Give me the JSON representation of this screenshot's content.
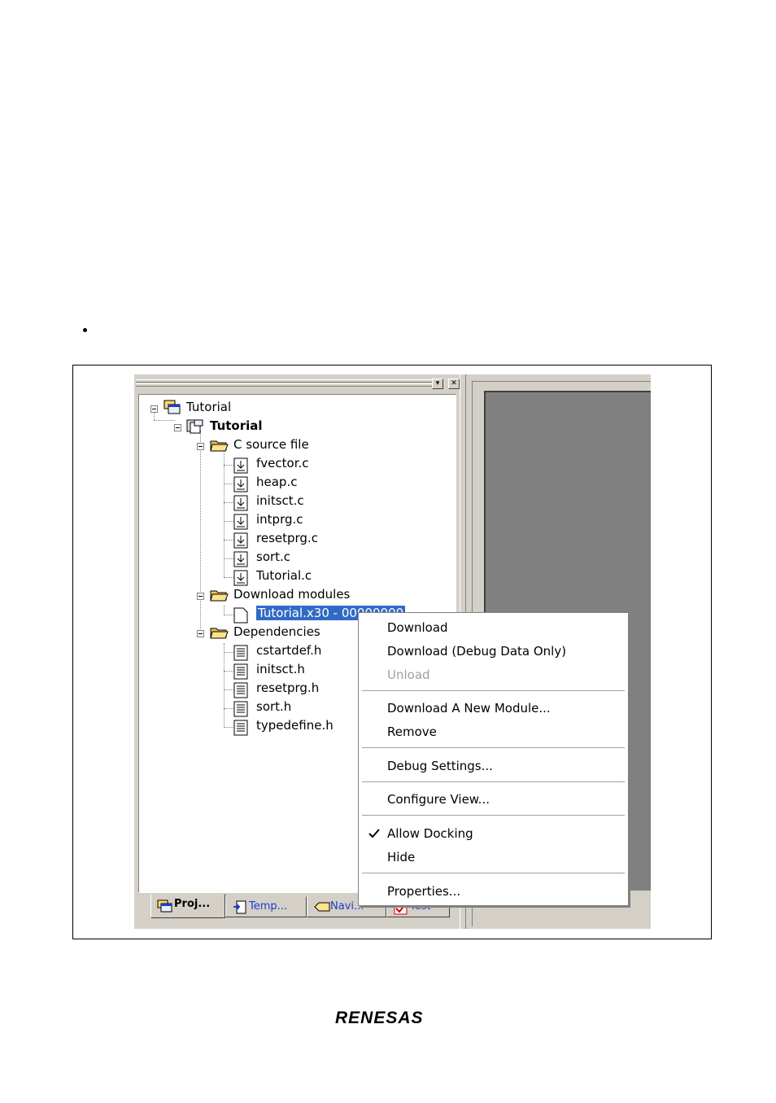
{
  "tree": {
    "root": "Tutorial",
    "project": "Tutorial",
    "c_source_folder": "C source file",
    "c_files": [
      "fvector.c",
      "heap.c",
      "initsct.c",
      "intprg.c",
      "resetprg.c",
      "sort.c",
      "Tutorial.c"
    ],
    "download_folder": "Download modules",
    "download_module": "Tutorial.x30 - 00000000",
    "dependencies_folder": "Dependencies",
    "h_files": [
      "cstartdef.h",
      "initsct.h",
      "resetprg.h",
      "sort.h",
      "typedefine.h"
    ]
  },
  "tabs": [
    "Proj...",
    "Temp...",
    "Navi...",
    "Test"
  ],
  "context_menu": {
    "download": "Download",
    "download_debug": "Download (Debug Data Only)",
    "unload": "Unload",
    "download_new": "Download A New Module...",
    "remove": "Remove",
    "debug_settings": "Debug Settings...",
    "configure_view": "Configure View...",
    "allow_docking": "Allow Docking",
    "allow_docking_checked": true,
    "hide": "Hide",
    "properties": "Properties..."
  },
  "footer_logo": "RENESAS",
  "colors": {
    "selection": "#316ac5",
    "panel": "#d4d0c8",
    "dark_area": "#808080"
  }
}
